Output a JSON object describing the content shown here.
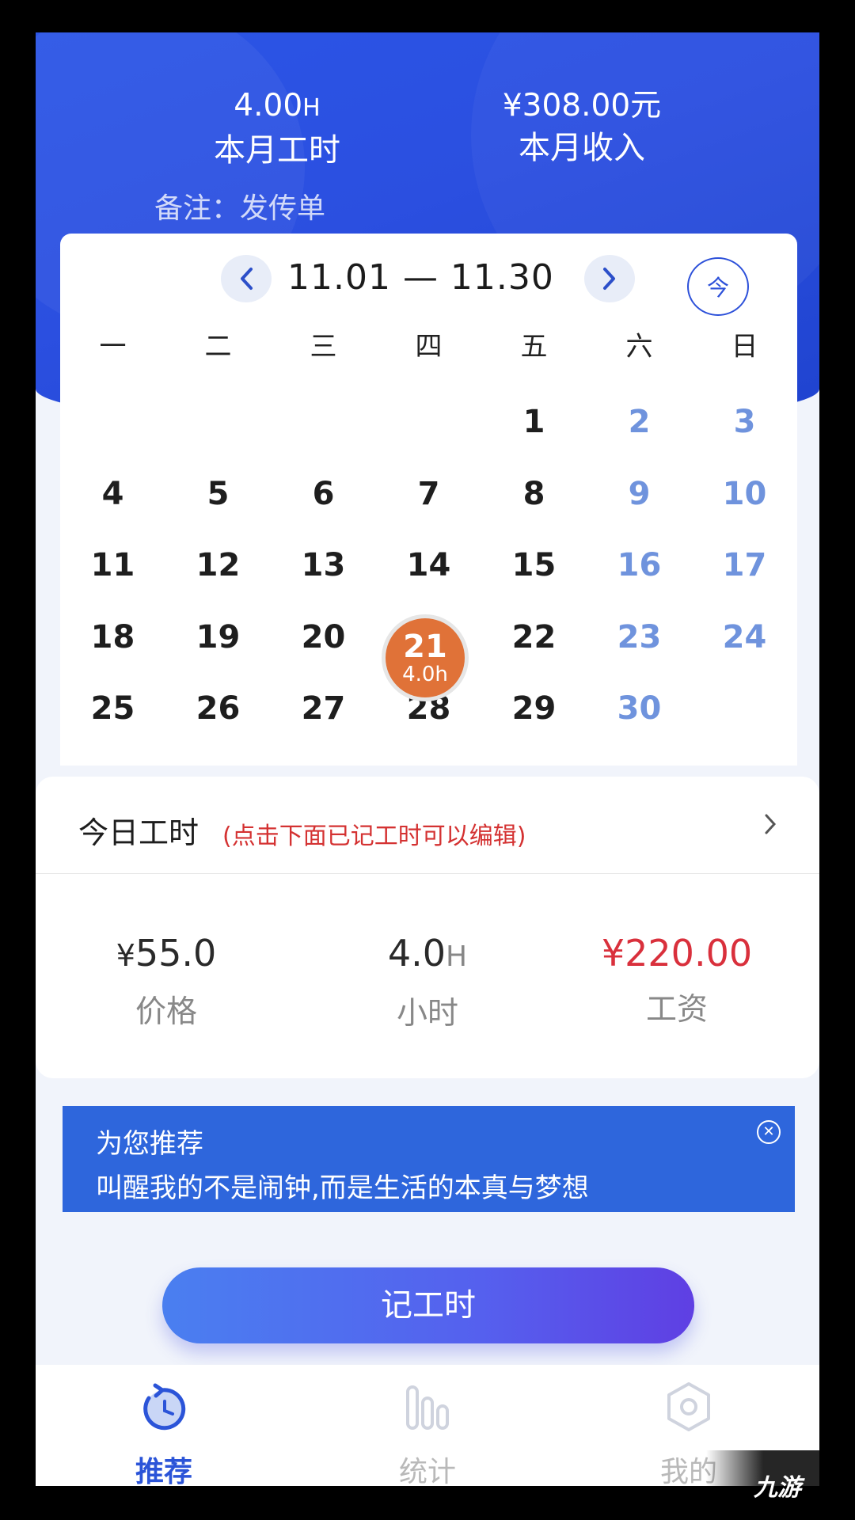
{
  "header": {
    "hours_value": "4.00",
    "hours_unit": "H",
    "hours_label": "本月工时",
    "income_value": "¥308.00元",
    "income_label": "本月收入",
    "note": "备注：发传单"
  },
  "calendar": {
    "range": "11.01 — 11.30",
    "today_button": "今",
    "weekdays": [
      "一",
      "二",
      "三",
      "四",
      "五",
      "六",
      "日"
    ],
    "selected_day": "21",
    "selected_hours": "4.0h"
  },
  "today": {
    "title": "今日工时",
    "hint": "(点击下面已记工时可以编辑)",
    "price_currency": "¥",
    "price_value": "55.0",
    "price_label": "价格",
    "hours_value": "4.0",
    "hours_unit": "H",
    "hours_label": "小时",
    "wage_value": "¥220.00",
    "wage_label": "工资"
  },
  "ad": {
    "title": "为您推荐",
    "text": "叫醒我的不是闹钟,而是生活的本真与梦想",
    "close_icon": "close-circle-icon"
  },
  "cta": {
    "label": "记工时"
  },
  "tabbar": {
    "items": [
      {
        "label": "推荐",
        "icon": "recommend-clock-icon",
        "active": true
      },
      {
        "label": "统计",
        "icon": "bar-chart-icon",
        "active": false
      },
      {
        "label": "我的",
        "icon": "profile-hexagon-icon",
        "active": false
      }
    ]
  },
  "watermark": "九游",
  "colors": {
    "primary": "#2b54d8",
    "selected_day": "#e07238",
    "weekend": "#6f93dd",
    "wage": "#d9303c"
  }
}
